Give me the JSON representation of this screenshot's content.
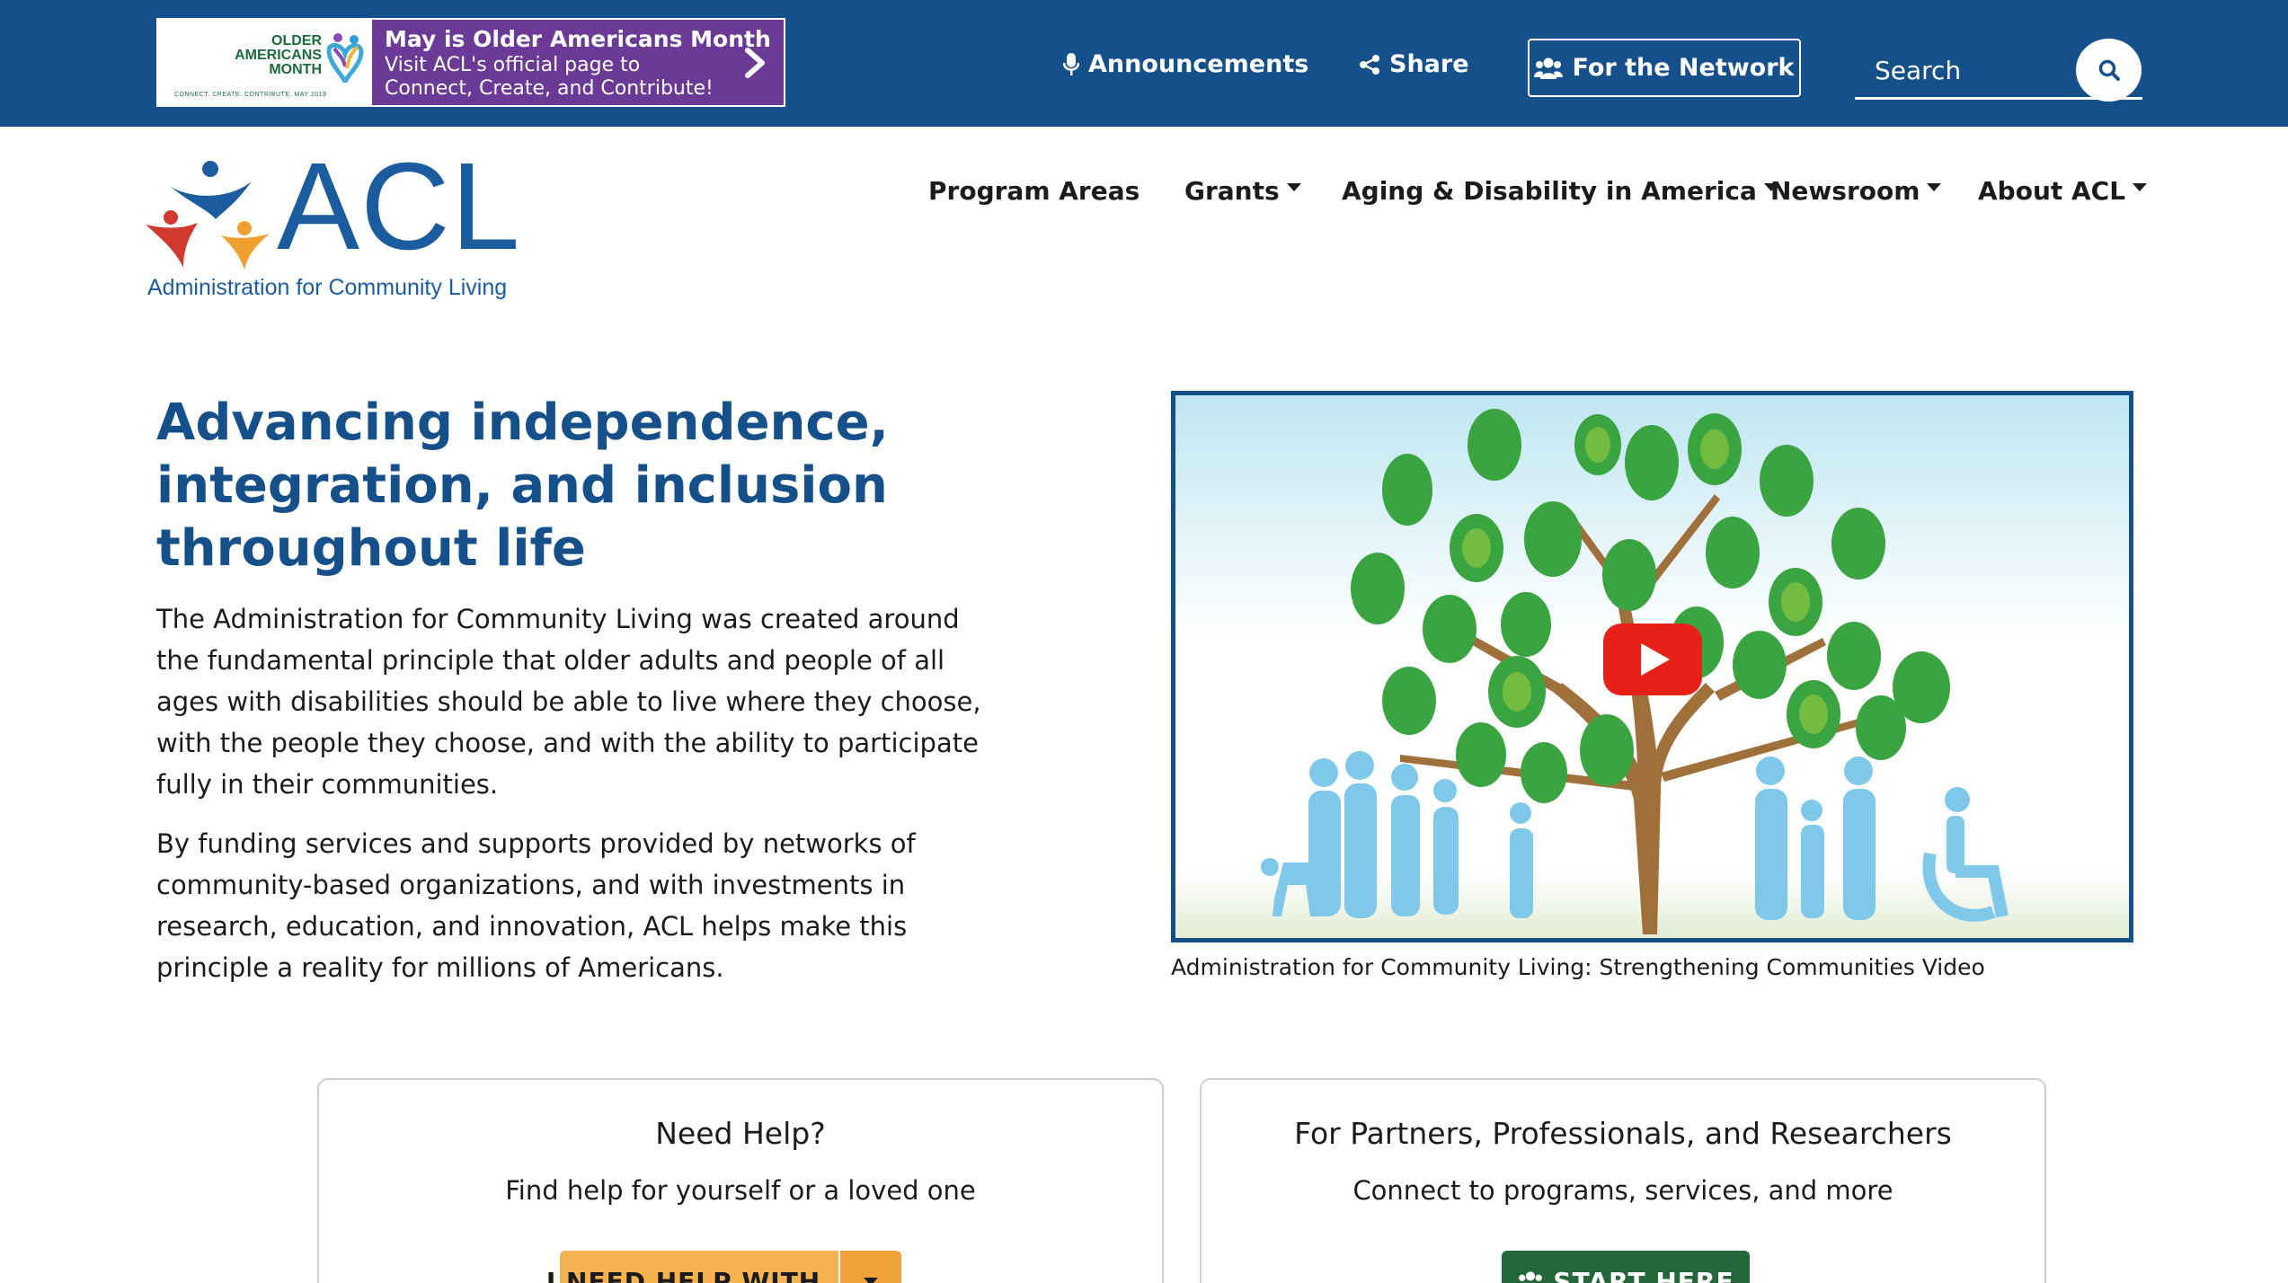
{
  "promo": {
    "logo_line1": "OLDER",
    "logo_line2": "AMERICANS",
    "logo_line3": "MONTH",
    "logo_tagline": "CONNECT. CREATE. CONTRIBUTE. MAY 2019",
    "title": "May is Older Americans Month",
    "line2": "Visit ACL's official page to",
    "line3": "Connect, Create, and Contribute!"
  },
  "utility": {
    "announcements": "Announcements",
    "share": "Share",
    "for_the_network": "For the Network",
    "search_placeholder": "Search"
  },
  "logo": {
    "acronym": "ACL",
    "full_name": "Administration for Community Living"
  },
  "nav": {
    "items": [
      {
        "label": "Program Areas",
        "has_dropdown": false
      },
      {
        "label": "Grants",
        "has_dropdown": true
      },
      {
        "label": "Aging & Disability in America",
        "has_dropdown": true
      },
      {
        "label": "Newsroom",
        "has_dropdown": true
      },
      {
        "label": "About ACL",
        "has_dropdown": true
      }
    ]
  },
  "hero": {
    "title": "Advancing independence, integration, and inclusion throughout life",
    "paragraph1": "The Administration for Community Living was created around the fundamental principle that older adults and people of all ages with disabilities should be able to live where they choose, with the people they choose, and with the ability to participate fully in their communities.",
    "paragraph2": "By funding services and supports provided by networks of community-based organizations, and with investments in research, education, and innovation, ACL helps make this principle a reality for millions of Americans."
  },
  "video": {
    "caption": "Administration for Community Living: Strengthening Communities Video",
    "play_icon": "youtube-play-icon"
  },
  "cards": [
    {
      "title": "Need Help?",
      "subtitle": "Find help for yourself or a loved one",
      "button": "I NEED HELP WITH..."
    },
    {
      "title": "For Partners, Professionals, and Researchers",
      "subtitle": "Connect to programs, services, and more",
      "button": "START HERE"
    }
  ],
  "colors": {
    "brand_blue": "#16508b",
    "promo_purple": "#6b3a96",
    "help_orange": "#f6b24f",
    "start_green": "#23673a"
  }
}
